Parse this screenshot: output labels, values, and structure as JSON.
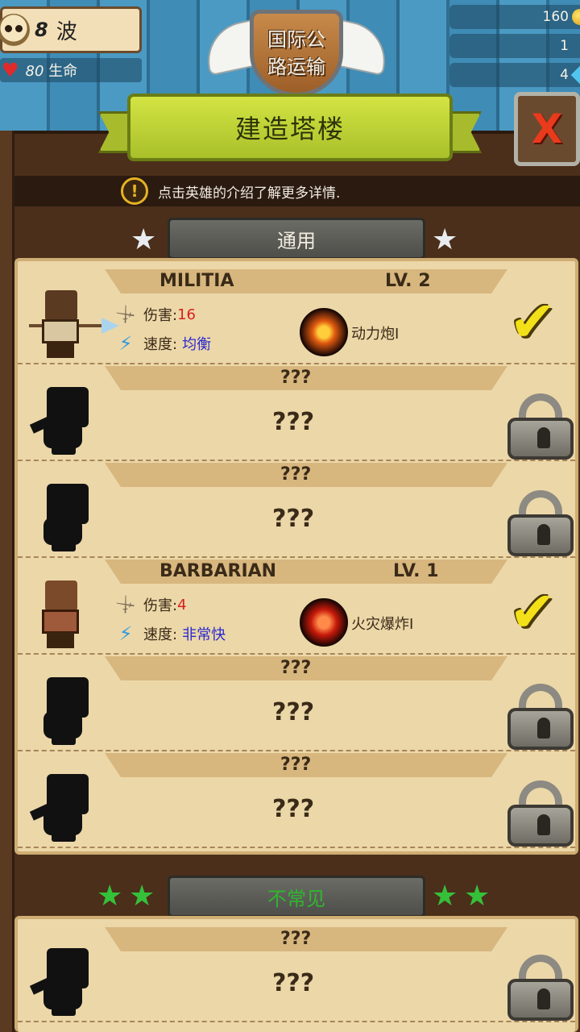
{
  "hud": {
    "wave_number": "8",
    "wave_label": "波",
    "life_value": "80",
    "life_label": "生命",
    "gold": "160",
    "resource_2": "1",
    "gems": "4"
  },
  "crest": {
    "line1": "国际公",
    "line2": "路运输"
  },
  "dialog": {
    "title": "建造塔楼",
    "close_label": "X",
    "info_text": "点击英雄的介绍了解更多详情."
  },
  "sections": [
    {
      "title": "通用",
      "title_color": "#f1ece0",
      "star_color": "#e8ecf0",
      "rows": [
        {
          "name": "MILITIA",
          "level": "LV. 2",
          "damage_label": "伤害:",
          "damage": "16",
          "speed_label": "速度:",
          "speed": "均衡",
          "skill": "动力炮I",
          "unlocked": true
        },
        {
          "name": "???",
          "big": "???",
          "unlocked": false
        },
        {
          "name": "???",
          "big": "???",
          "unlocked": false
        },
        {
          "name": "BARBARIAN",
          "level": "LV. 1",
          "damage_label": "伤害:",
          "damage": "4",
          "speed_label": "速度:",
          "speed": "非常快",
          "skill": "火灾爆炸I",
          "unlocked": true
        },
        {
          "name": "???",
          "big": "???",
          "unlocked": false
        },
        {
          "name": "???",
          "big": "???",
          "unlocked": false
        }
      ]
    },
    {
      "title": "不常见",
      "title_color": "#2fb62f",
      "star_color": "#36c03a",
      "rows": [
        {
          "name": "???",
          "big": "???",
          "unlocked": false
        }
      ]
    }
  ]
}
